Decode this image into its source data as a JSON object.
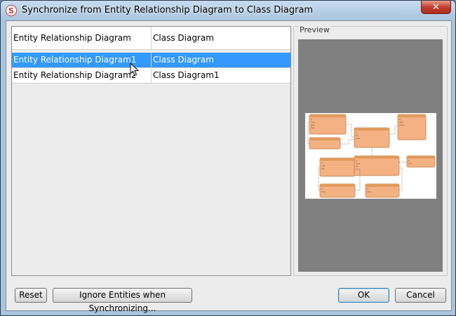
{
  "window": {
    "title": "Synchronize from Entity Relationship Diagram to Class Diagram",
    "close_glyph": "✕"
  },
  "table": {
    "headers": [
      "Entity Relationship Diagram",
      "Class Diagram"
    ],
    "rows": [
      {
        "erd": "Entity Relationship Diagram1",
        "class": "Class Diagram",
        "selected": true
      },
      {
        "erd": "Entity Relationship Diagram2",
        "class": "Class Diagram1",
        "selected": false
      }
    ]
  },
  "preview": {
    "label": "Preview"
  },
  "buttons": {
    "reset": "Reset",
    "ignore": "Ignore Entities when Synchronizing...",
    "ok": "OK",
    "cancel": "Cancel"
  },
  "colors": {
    "selection": "#3399ff",
    "preview_bg": "#808080",
    "entity_fill": "#f4b183",
    "entity_stroke": "#c07a3a"
  }
}
